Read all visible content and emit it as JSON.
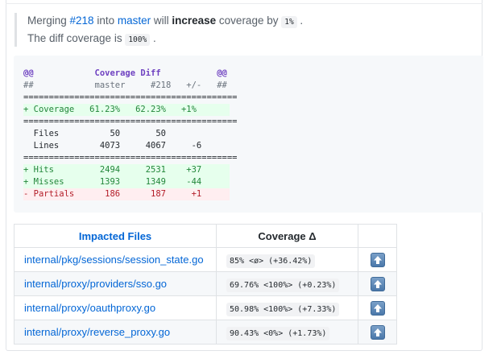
{
  "summary": {
    "prefix": "Merging ",
    "pr": "#218",
    "into": " into ",
    "branch": "master",
    "will": " will ",
    "verb": "increase",
    "coverage_by": " coverage by ",
    "delta": "1%",
    "period1": " .",
    "diff_prefix": "The diff coverage is ",
    "diff_value": "100%",
    "period2": " ."
  },
  "coverage_diff": {
    "lines": [
      {
        "kind": "hdr",
        "text": "@@            Coverage Diff           @@"
      },
      {
        "kind": "sub",
        "text": "##            master     #218   +/-   ##"
      },
      {
        "kind": "sep",
        "text": "=========================================="
      },
      {
        "kind": "add",
        "text": "+ Coverage   61.23%   62.23%   +1%       "
      },
      {
        "kind": "sep",
        "text": "=========================================="
      },
      {
        "kind": "plain",
        "text": "  Files          50       50             "
      },
      {
        "kind": "plain",
        "text": "  Lines        4073     4067     -6      "
      },
      {
        "kind": "sep",
        "text": "=========================================="
      },
      {
        "kind": "add",
        "text": "+ Hits         2494     2531    +37      "
      },
      {
        "kind": "add",
        "text": "+ Misses       1393     1349    -44      "
      },
      {
        "kind": "del",
        "text": "- Partials      186      187     +1      "
      }
    ]
  },
  "impacted": {
    "headers": {
      "file": "Impacted Files",
      "coverage": "Coverage Δ"
    },
    "rows": [
      {
        "file": "internal/pkg/sessions/session_state.go",
        "coverage": "85% <ø> (+36.42%)",
        "arrow_icon": "arrow-up-icon"
      },
      {
        "file": "internal/proxy/providers/sso.go",
        "coverage": "69.76% <100%> (+0.23%)",
        "arrow_icon": "arrow-up-icon"
      },
      {
        "file": "internal/proxy/oauthproxy.go",
        "coverage": "50.98% <100%> (+7.33%)",
        "arrow_icon": "arrow-up-icon"
      },
      {
        "file": "internal/proxy/reverse_proxy.go",
        "coverage": "90.43% <0%> (+1.73%)",
        "arrow_icon": "arrow-up-icon"
      }
    ]
  },
  "colors": {
    "link": "#0366d6",
    "added": "#22863a",
    "removed": "#b31d28",
    "hunk": "#6f42c1"
  }
}
